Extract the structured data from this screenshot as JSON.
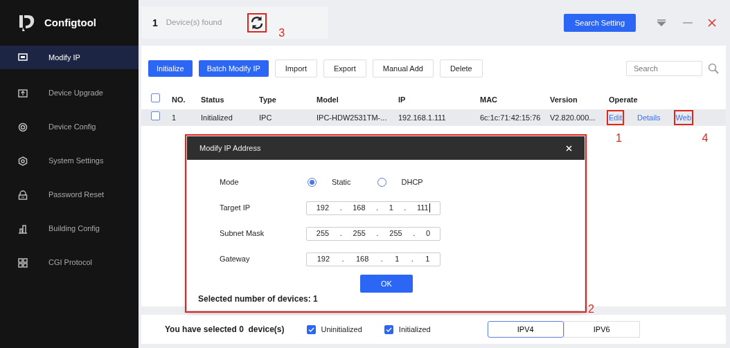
{
  "sidebar": {
    "app_name": "Configtool",
    "items": [
      {
        "label": "Modify IP",
        "selected": true
      },
      {
        "label": "Device Upgrade",
        "selected": false
      },
      {
        "label": "Device Config",
        "selected": false
      },
      {
        "label": "System Settings",
        "selected": false
      },
      {
        "label": "Password Reset",
        "selected": false
      },
      {
        "label": "Building Config",
        "selected": false
      },
      {
        "label": "CGI Protocol",
        "selected": false
      }
    ]
  },
  "header": {
    "count": "1",
    "found_label": "Device(s) found",
    "refresh_annotation": "3",
    "search_setting": "Search Setting"
  },
  "toolbar": {
    "buttons": [
      {
        "label": "Initialize",
        "kind": "primary"
      },
      {
        "label": "Batch Modify IP",
        "kind": "primary"
      },
      {
        "label": "Import",
        "kind": "outline"
      },
      {
        "label": "Export",
        "kind": "outline"
      },
      {
        "label": "Manual Add",
        "kind": "outline"
      },
      {
        "label": "Delete",
        "kind": "outline"
      }
    ],
    "search_placeholder": "Search"
  },
  "table": {
    "all_checked": false,
    "columns": [
      "NO.",
      "Status",
      "Type",
      "Model",
      "IP",
      "MAC",
      "Version",
      "Operate"
    ],
    "rows": [
      {
        "checked": false,
        "cells": [
          "1",
          "Initialized",
          "IPC",
          "IPC-HDW2531TM-...",
          "192.168.1.111",
          "6c:1c:71:42:15:76",
          "V2.820.000..."
        ],
        "actions": [
          {
            "label": "Edit",
            "annotation": "1"
          },
          {
            "label": "Details"
          },
          {
            "label": "Web",
            "annotation": "4"
          }
        ]
      }
    ]
  },
  "dialog": {
    "title": "Modify IP Address",
    "annotation": "2",
    "mode_label": "Mode",
    "modes": [
      {
        "label": "Static",
        "selected": true
      },
      {
        "label": "DHCP",
        "selected": false
      }
    ],
    "fields": [
      {
        "label": "Target IP",
        "parts": [
          "192",
          ".",
          "168",
          ".",
          "1",
          ".",
          "111"
        ],
        "focused": true
      },
      {
        "label": "Subnet Mask",
        "parts": [
          "255",
          ".",
          "255",
          ".",
          "255",
          ".",
          "0"
        ],
        "focused": false
      },
      {
        "label": "Gateway",
        "parts": [
          "192",
          ".",
          "168",
          ".",
          "1",
          ".",
          "1"
        ],
        "focused": false
      }
    ],
    "ok": "OK",
    "summary": "Selected number of devices: 1"
  },
  "footer": {
    "selected_text": "You have selected 0  device(s)",
    "filters": [
      {
        "label": "Uninitialized",
        "checked": true
      },
      {
        "label": "Initialized",
        "checked": true
      }
    ],
    "ip_tabs": [
      {
        "label": "IPV4",
        "selected": true
      },
      {
        "label": "IPV6",
        "selected": false
      }
    ]
  }
}
